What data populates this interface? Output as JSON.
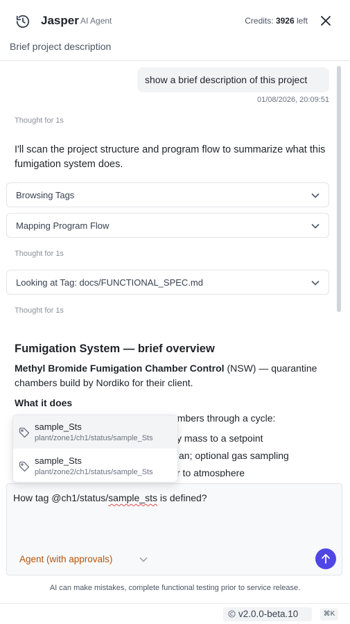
{
  "header": {
    "agent_name": "Jasper",
    "agent_role": "AI Agent",
    "credits_label": "Credits:",
    "credits_value": "3926",
    "credits_suffix": "left",
    "subtitle": "Brief project description"
  },
  "chat": {
    "user_message": "show a brief description of this project",
    "user_timestamp": "01/08/2026, 20:09:51",
    "thought_label": "Thought for 1s",
    "reply_intro": "I'll scan the project structure and program flow to summarize what this fumigation system does.",
    "steps": [
      {
        "label": "Browsing Tags"
      },
      {
        "label": "Mapping Program Flow"
      },
      {
        "label": "Looking at Tag: docs/FUNCTIONAL_SPEC.md"
      }
    ],
    "overview": {
      "title": "Fumigation System — brief overview",
      "desc_bold": "Methyl Bromide Fumigation Chamber Control",
      "desc_rest": " (NSW) — quarantine chambers build by Nordiko for their client.",
      "what_title": "What it does",
      "partial_line_1": "umbers through a cycle:",
      "partial_line_2": "y mass to a setpoint",
      "partial_line_3": "an; optional gas sampling",
      "partial_line_4": "r to atmosphere"
    }
  },
  "tag_popup": {
    "items": [
      {
        "name": "sample_Sts",
        "path": "plant/zone1/ch1/status/sample_Sts"
      },
      {
        "name": "sample_Sts",
        "path": "plant/zone2/ch1/status/sample_Sts"
      }
    ]
  },
  "composer": {
    "text_before": "How tag @ch1/status/",
    "text_misspelled": "sample_sts",
    "text_after": " is defined?",
    "mode_label": "Agent (with approvals)"
  },
  "disclaimer": "AI can make mistakes, complete functional testing prior to service release.",
  "footer": {
    "version": "v2.0.0-beta.10",
    "shortcut": "⌘K"
  },
  "colors": {
    "accent": "#4f46e5",
    "mode_text": "#b45309"
  }
}
